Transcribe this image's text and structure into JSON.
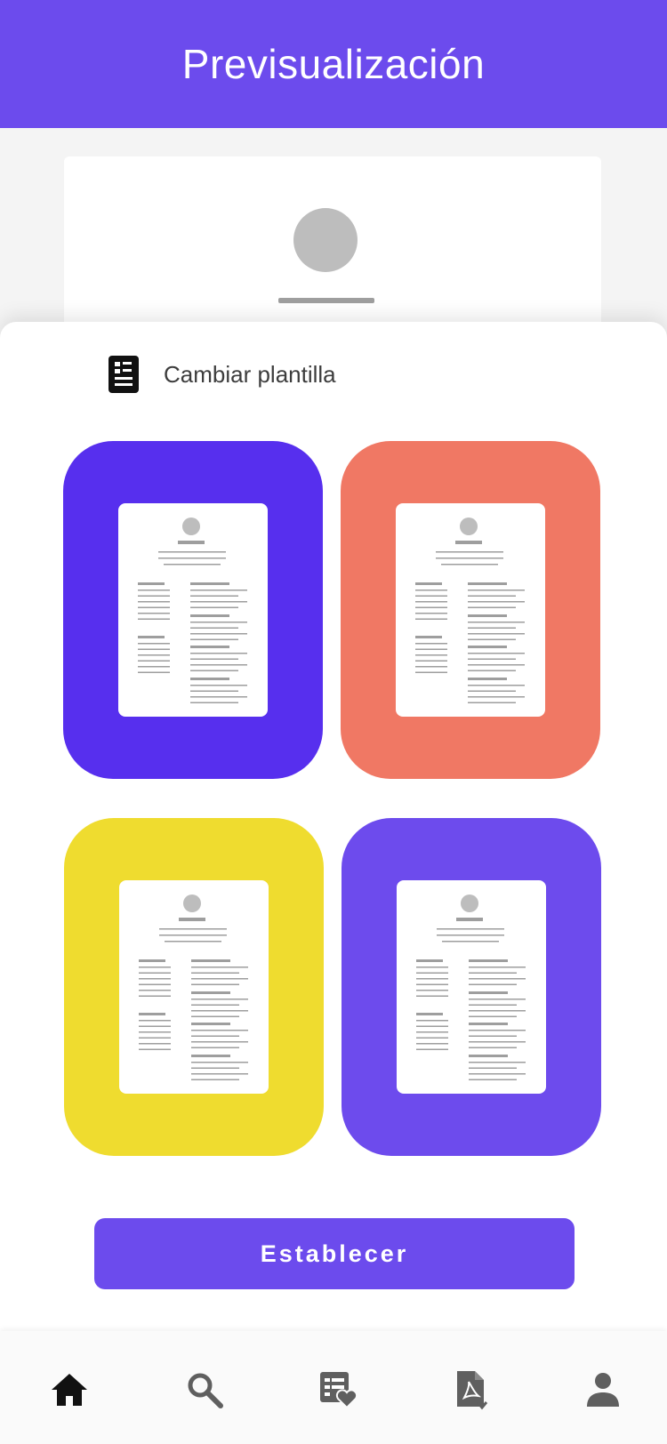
{
  "app_bar": {
    "title": "Previsualización"
  },
  "sheet": {
    "title": "Cambiar plantilla"
  },
  "templates": [
    {
      "color": "#572fee"
    },
    {
      "color": "#f07864"
    },
    {
      "color": "#efdc2f"
    },
    {
      "color": "#6d4bed"
    }
  ],
  "actions": {
    "establish_label": "Establecer"
  },
  "bottom_nav": {
    "items": [
      {
        "icon": "home-icon",
        "active": true
      },
      {
        "icon": "search-icon",
        "active": false
      },
      {
        "icon": "favorite-list-icon",
        "active": false
      },
      {
        "icon": "pdf-download-icon",
        "active": false
      },
      {
        "icon": "person-icon",
        "active": false
      }
    ]
  }
}
